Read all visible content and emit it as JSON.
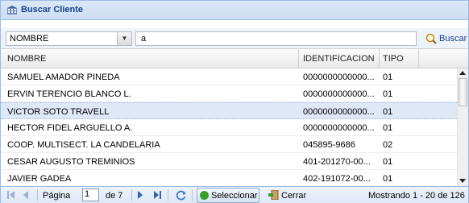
{
  "window": {
    "title": "Buscar Cliente"
  },
  "toolbar": {
    "field_select": "NOMBRE",
    "search_value": "a",
    "search_button": "Buscar"
  },
  "grid": {
    "columns": [
      "NOMBRE",
      "IDENTIFICACION",
      "TIPO"
    ],
    "rows": [
      {
        "nombre": "SAMUEL AMADOR PINEDA",
        "identificacion": "0000000000000...",
        "tipo": "01"
      },
      {
        "nombre": "ERVIN TERENCIO BLANCO L.",
        "identificacion": "0000000000000...",
        "tipo": "01"
      },
      {
        "nombre": "VICTOR SOTO TRAVELL",
        "identificacion": "0000000000000...",
        "tipo": "01"
      },
      {
        "nombre": "HECTOR FIDEL ARGUELLO A.",
        "identificacion": "0000000000000...",
        "tipo": "01"
      },
      {
        "nombre": "COOP. MULTISECT. LA CANDELARIA",
        "identificacion": "045895-9686",
        "tipo": "02"
      },
      {
        "nombre": "CESAR AUGUSTO TREMINIOS",
        "identificacion": "401-201270-00...",
        "tipo": "01"
      },
      {
        "nombre": "JAVIER GADEA",
        "identificacion": "402-191072-00...",
        "tipo": "01"
      }
    ]
  },
  "pager": {
    "page_label": "Página",
    "page_value": "1",
    "of_label": "de 7",
    "select_button": "Seleccionar",
    "close_button": "Cerrar",
    "display_info": "Mostrando 1 - 20 de 126"
  }
}
